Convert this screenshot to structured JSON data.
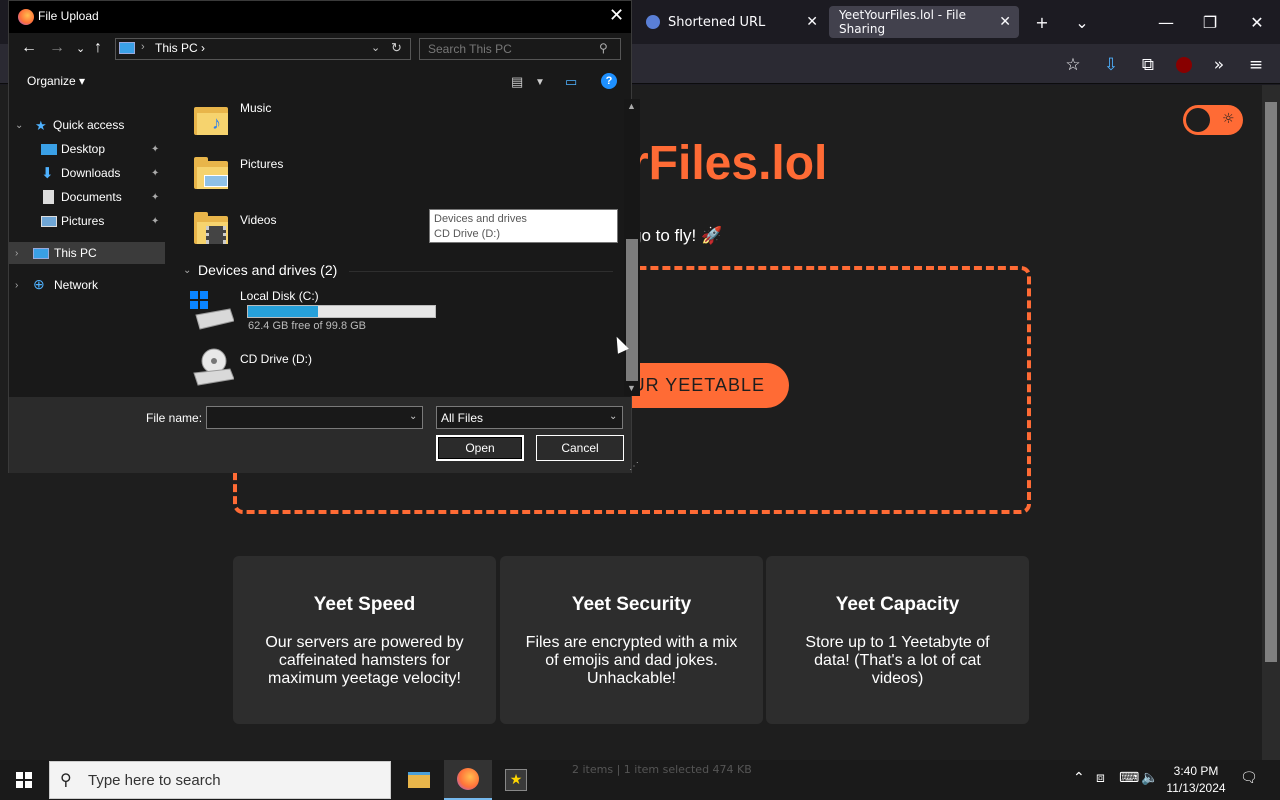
{
  "browser": {
    "tabs": [
      {
        "title": "Shortened URL"
      },
      {
        "title": "YeetYourFiles.lol - File Sharing"
      }
    ],
    "new_tab_icon": "+",
    "tab_list_icon": "chevron-down-icon"
  },
  "page": {
    "title": "rFiles.lol",
    "tagline": "go to fly! 🚀",
    "upload_button": "UR YEETABLE",
    "features": [
      {
        "title": "Yeet Speed",
        "text": "Our servers are powered by caffeinated hamsters for maximum yeetage velocity!"
      },
      {
        "title": "Yeet Security",
        "text": "Files are encrypted with a mix of emojis and dad jokes. Unhackable!"
      },
      {
        "title": "Yeet Capacity",
        "text": "Store up to 1 Yeetabyte of data! (That's a lot of cat videos)"
      }
    ],
    "ghost_status": "2 items | 1 item selected 474 KB"
  },
  "dialog": {
    "title": "File Upload",
    "address": "This PC",
    "search_placeholder": "Search This PC",
    "organize": "Organize ▾",
    "nav": {
      "quick_access": "Quick access",
      "items": [
        "Desktop",
        "Downloads",
        "Documents",
        "Pictures"
      ],
      "this_pc": "This PC",
      "network": "Network"
    },
    "folders": [
      "Music",
      "Pictures",
      "Videos"
    ],
    "group_header": "Devices and drives (2)",
    "drives": [
      {
        "name": "Local Disk (C:)",
        "free": "62.4 GB free of 99.8 GB",
        "used_fraction": 0.375
      },
      {
        "name": "CD Drive (D:)"
      }
    ],
    "tooltip": {
      "line1": "Devices and drives",
      "line2": "CD Drive (D:)"
    },
    "filename_label": "File name:",
    "filename_value": "",
    "filetype": "All Files",
    "open": "Open",
    "cancel": "Cancel"
  },
  "taskbar": {
    "search_placeholder": "Type here to search",
    "time": "3:40 PM",
    "date": "11/13/2024"
  },
  "colors": {
    "accent": "#ff6b35",
    "selection": "#26a0da"
  }
}
